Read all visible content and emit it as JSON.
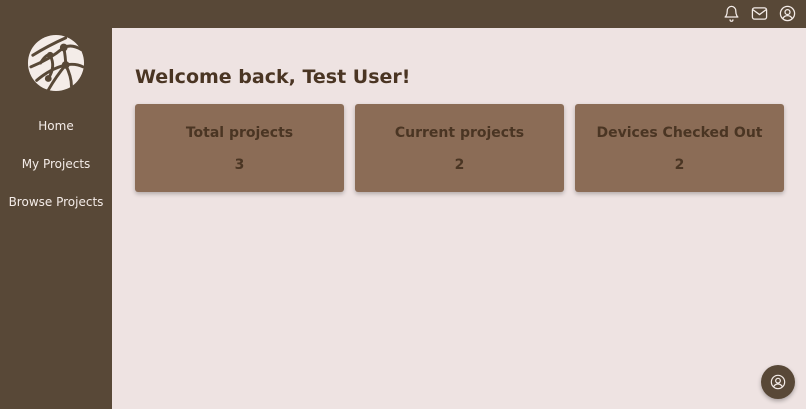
{
  "topbar": {
    "icons": [
      "bell-icon",
      "mail-icon",
      "user-circle-icon"
    ]
  },
  "sidebar": {
    "logo": "network-globe-logo",
    "items": [
      {
        "label": "Home"
      },
      {
        "label": "My Projects"
      },
      {
        "label": "Browse Projects"
      }
    ]
  },
  "main": {
    "welcome": "Welcome back, Test User!",
    "cards": [
      {
        "title": "Total projects",
        "value": "3"
      },
      {
        "title": "Current projects",
        "value": "2"
      },
      {
        "title": "Devices Checked Out",
        "value": "2"
      }
    ]
  },
  "fab": {
    "icon": "user-circle-icon"
  },
  "colors": {
    "sidebar": "#584837",
    "background": "#eee3e2",
    "card": "#8b6c56",
    "text_dark": "#4a3523",
    "text_light": "#f4ece8"
  }
}
